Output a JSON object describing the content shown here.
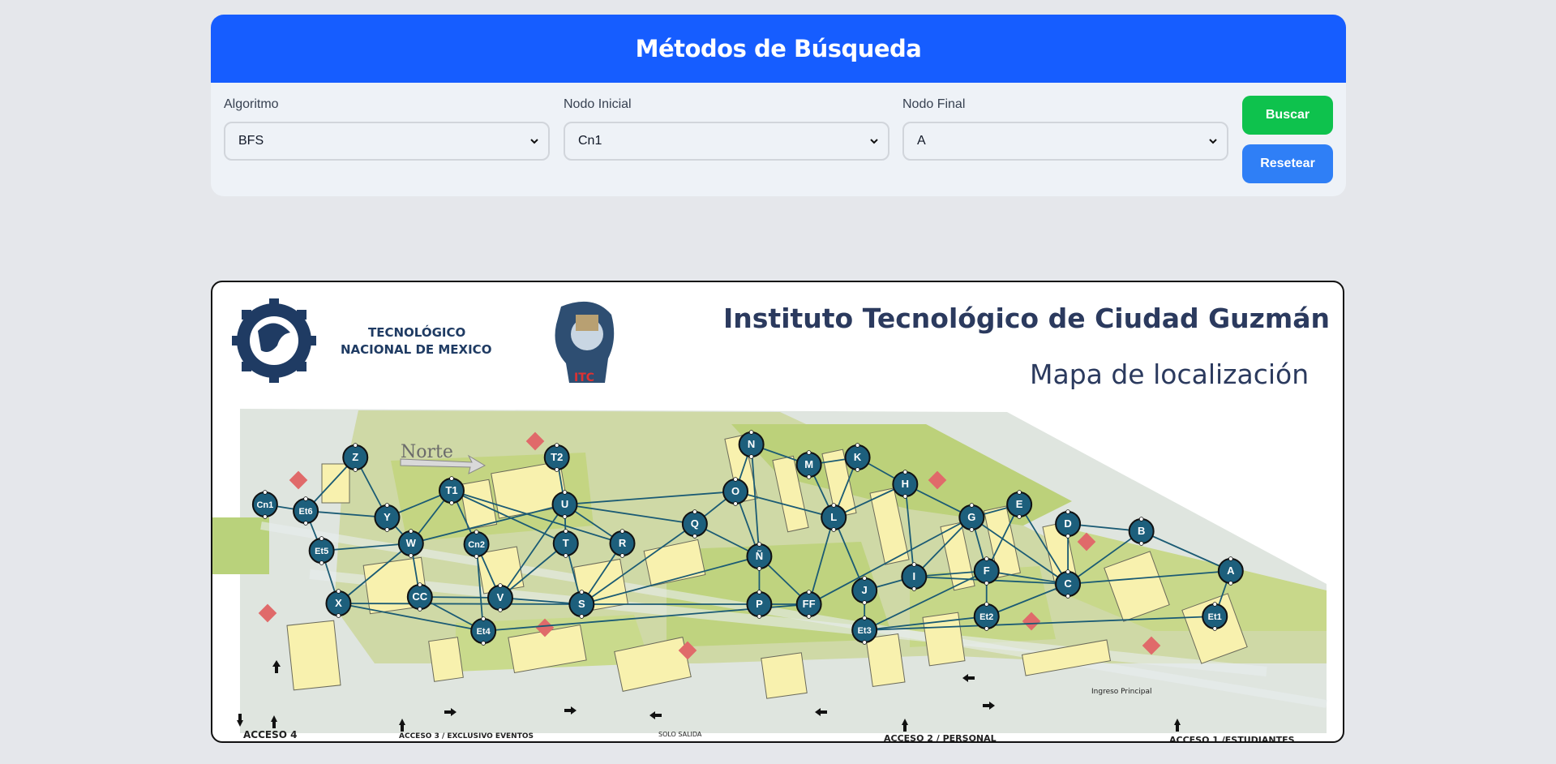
{
  "header": {
    "title": "Métodos de Búsqueda"
  },
  "controls": {
    "algorithm": {
      "label": "Algoritmo",
      "value": "BFS"
    },
    "start_node": {
      "label": "Nodo Inicial",
      "value": "Cn1"
    },
    "end_node": {
      "label": "Nodo Final",
      "value": "A"
    },
    "search_label": "Buscar",
    "reset_label": "Resetear"
  },
  "map": {
    "institute_title": "Instituto Tecnológico de Ciudad Guzmán",
    "subtitle": "Mapa de localización",
    "tecnm_logo_text": [
      "TECNOLÓGICO",
      "NACIONAL DE MEXICO"
    ],
    "itc_logo_text": "ITC",
    "north_label": "Norte",
    "main_entrance_label": "Ingreso Principal",
    "access_labels": {
      "acceso4": "ACCESO 4",
      "acceso3": "ACCESO 3 / EXCLUSIVO EVENTOS",
      "solo_salida": "SOLO SALIDA",
      "acceso2": "ACCESO 2 / PERSONAL",
      "acceso1": "ACCESO 1 /ESTUDIANTES"
    },
    "colors": {
      "node_fill": "#1d5f7c",
      "edge": "#1b5b74",
      "header": "#165dff",
      "search_button": "#0ec24d",
      "reset_button": "#2f7ff6",
      "title_text": "#2b3a5e"
    },
    "nodes": [
      "Cn1",
      "Et6",
      "Z",
      "Y",
      "Et5",
      "W",
      "T1",
      "Cn2",
      "X",
      "CC",
      "V",
      "Et4",
      "T2",
      "U",
      "T",
      "R",
      "S",
      "O",
      "N",
      "Q",
      "Ñ",
      "P",
      "M",
      "K",
      "L",
      "FF",
      "J",
      "Et3",
      "H",
      "I",
      "G",
      "F",
      "Et2",
      "E",
      "D",
      "C",
      "B",
      "A",
      "Et1"
    ],
    "edges": [
      [
        "Cn1",
        "Et6"
      ],
      [
        "Et6",
        "Y"
      ],
      [
        "Et6",
        "Z"
      ],
      [
        "Et6",
        "Et5"
      ],
      [
        "Z",
        "Y"
      ],
      [
        "Y",
        "T1"
      ],
      [
        "Y",
        "W"
      ],
      [
        "Et5",
        "W"
      ],
      [
        "Et5",
        "X"
      ],
      [
        "W",
        "T1"
      ],
      [
        "W",
        "CC"
      ],
      [
        "W",
        "X"
      ],
      [
        "W",
        "U"
      ],
      [
        "T1",
        "Cn2"
      ],
      [
        "T1",
        "T"
      ],
      [
        "T1",
        "R"
      ],
      [
        "Cn2",
        "V"
      ],
      [
        "Cn2",
        "Et4"
      ],
      [
        "X",
        "S"
      ],
      [
        "X",
        "Et4"
      ],
      [
        "CC",
        "Et4"
      ],
      [
        "CC",
        "V"
      ],
      [
        "V",
        "U"
      ],
      [
        "V",
        "S"
      ],
      [
        "V",
        "T"
      ],
      [
        "T2",
        "U"
      ],
      [
        "U",
        "T"
      ],
      [
        "U",
        "R"
      ],
      [
        "U",
        "O"
      ],
      [
        "U",
        "Q"
      ],
      [
        "T",
        "S"
      ],
      [
        "R",
        "S"
      ],
      [
        "S",
        "Ñ"
      ],
      [
        "S",
        "P"
      ],
      [
        "S",
        "Q"
      ],
      [
        "O",
        "N"
      ],
      [
        "O",
        "Ñ"
      ],
      [
        "O",
        "L"
      ],
      [
        "O",
        "Q"
      ],
      [
        "N",
        "M"
      ],
      [
        "N",
        "Ñ"
      ],
      [
        "M",
        "K"
      ],
      [
        "M",
        "L"
      ],
      [
        "K",
        "H"
      ],
      [
        "K",
        "L"
      ],
      [
        "Ñ",
        "P"
      ],
      [
        "Ñ",
        "FF"
      ],
      [
        "Q",
        "Ñ"
      ],
      [
        "L",
        "FF"
      ],
      [
        "L",
        "J"
      ],
      [
        "L",
        "H"
      ],
      [
        "P",
        "FF"
      ],
      [
        "FF",
        "G"
      ],
      [
        "FF",
        "Et4"
      ],
      [
        "H",
        "G"
      ],
      [
        "H",
        "I"
      ],
      [
        "J",
        "Et3"
      ],
      [
        "J",
        "I"
      ],
      [
        "I",
        "G"
      ],
      [
        "I",
        "F"
      ],
      [
        "I",
        "C"
      ],
      [
        "Et3",
        "F"
      ],
      [
        "Et3",
        "Et2"
      ],
      [
        "Et3",
        "Et1"
      ],
      [
        "G",
        "F"
      ],
      [
        "G",
        "E"
      ],
      [
        "G",
        "C"
      ],
      [
        "E",
        "F"
      ],
      [
        "E",
        "C"
      ],
      [
        "D",
        "C"
      ],
      [
        "D",
        "B"
      ],
      [
        "F",
        "Et2"
      ],
      [
        "F",
        "C"
      ],
      [
        "C",
        "B"
      ],
      [
        "C",
        "A"
      ],
      [
        "B",
        "A"
      ],
      [
        "A",
        "Et1"
      ],
      [
        "Et2",
        "C"
      ]
    ]
  }
}
